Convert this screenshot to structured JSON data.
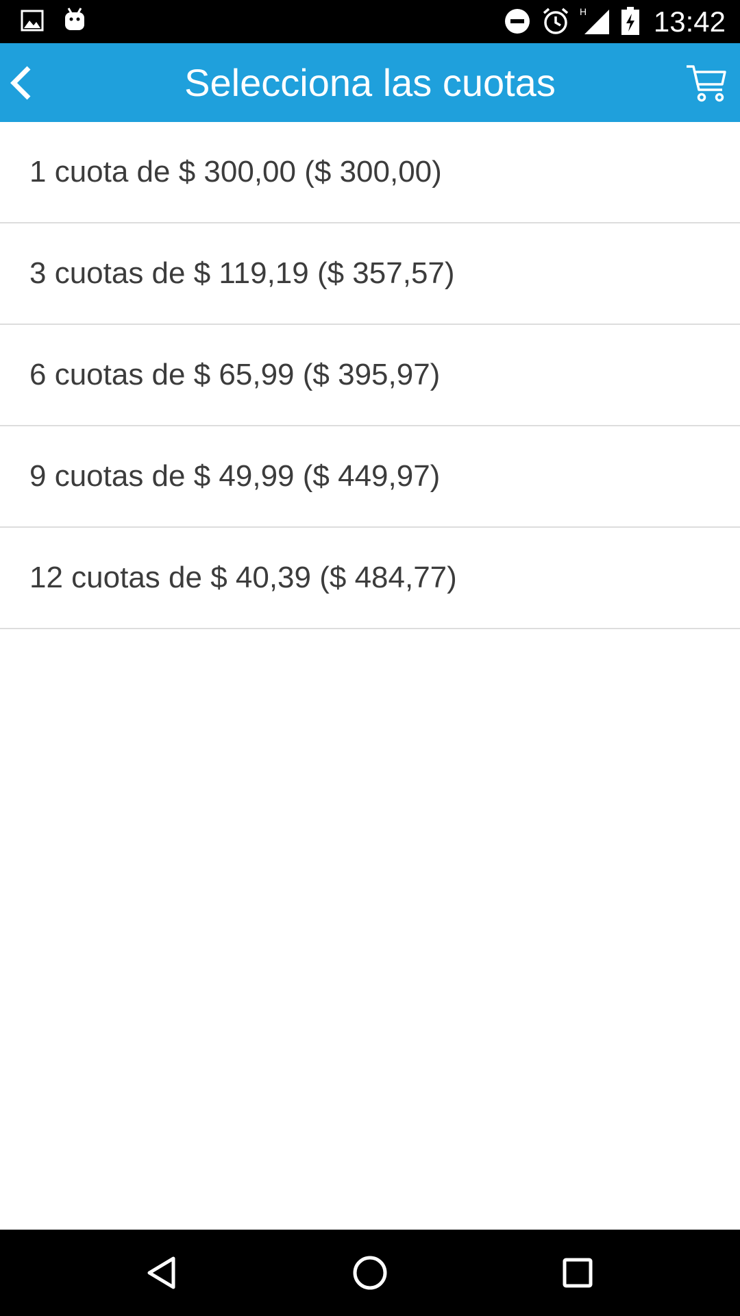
{
  "status_bar": {
    "time": "13:42",
    "icons": [
      "image-icon",
      "android-debug-icon",
      "do-not-disturb-icon",
      "alarm-icon",
      "signal-h-icon",
      "battery-charging-icon"
    ],
    "signal_label": "H"
  },
  "app_bar": {
    "title": "Selecciona las cuotas",
    "background": "#1fa0dc",
    "back_icon": "chevron-left-icon",
    "cart_icon": "cart-icon"
  },
  "installments": {
    "items": [
      {
        "label": "1 cuota de $ 300,00 ($ 300,00)"
      },
      {
        "label": "3 cuotas de $ 119,19 ($ 357,57)"
      },
      {
        "label": "6 cuotas de $ 65,99 ($ 395,97)"
      },
      {
        "label": "9 cuotas de $ 49,99 ($ 449,97)"
      },
      {
        "label": "12 cuotas de $ 40,39 ($ 484,77)"
      }
    ]
  },
  "nav_bar": {
    "buttons": [
      "back-triangle-icon",
      "home-circle-icon",
      "recents-square-icon"
    ]
  }
}
